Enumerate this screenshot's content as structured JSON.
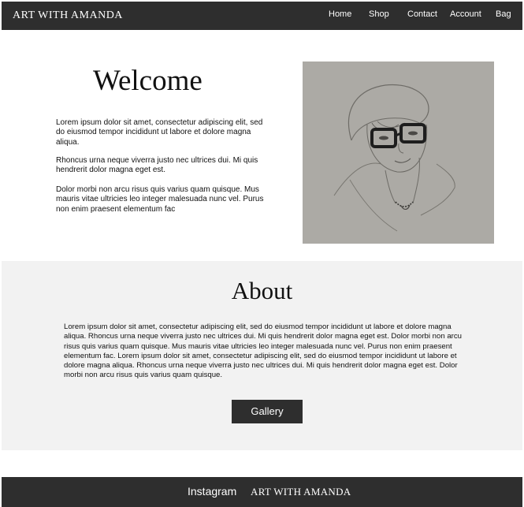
{
  "nav": {
    "brand": "ART WITH AMANDA",
    "links": [
      "Home",
      "Shop",
      "Contact",
      "Account",
      "Bag"
    ]
  },
  "hero": {
    "title": "Welcome",
    "paragraphs": [
      "Lorem ipsum dolor sit amet, consectetur adipiscing elit, sed do eiusmod tempor incididunt ut labore et dolore magna aliqua.",
      " Rhoncus urna neque viverra justo nec ultrices dui. Mi quis hendrerit dolor magna eget est.",
      "Dolor morbi non arcu risus quis varius quam quisque. Mus mauris vitae ultricies leo integer malesuada nunc vel. Purus non enim praesent elementum fac"
    ],
    "image": "pencil-portrait"
  },
  "about": {
    "title": "About",
    "text": "Lorem ipsum dolor sit amet, consectetur adipiscing elit, sed do eiusmod tempor incididunt ut labore et dolore magna aliqua. Rhoncus urna neque viverra justo nec ultrices dui. Mi quis hendrerit dolor magna eget est. Dolor morbi non arcu risus quis varius quam quisque. Mus mauris vitae ultricies leo integer malesuada nunc vel. Purus non enim praesent elementum fac. Lorem ipsum dolor sit amet, consectetur adipiscing elit, sed do eiusmod tempor incididunt ut labore et dolore magna aliqua. Rhoncus urna neque viverra justo nec ultrices dui. Mi quis hendrerit dolor magna eget est. Dolor morbi non arcu risus quis varius quam quisque.",
    "button": "Gallery"
  },
  "footer": {
    "link": "Instagram",
    "brand": "ART WITH AMANDA"
  },
  "colors": {
    "dark": "#2e2e2e",
    "light_section": "#f2f2f2",
    "paper": "#a9a7a1"
  }
}
